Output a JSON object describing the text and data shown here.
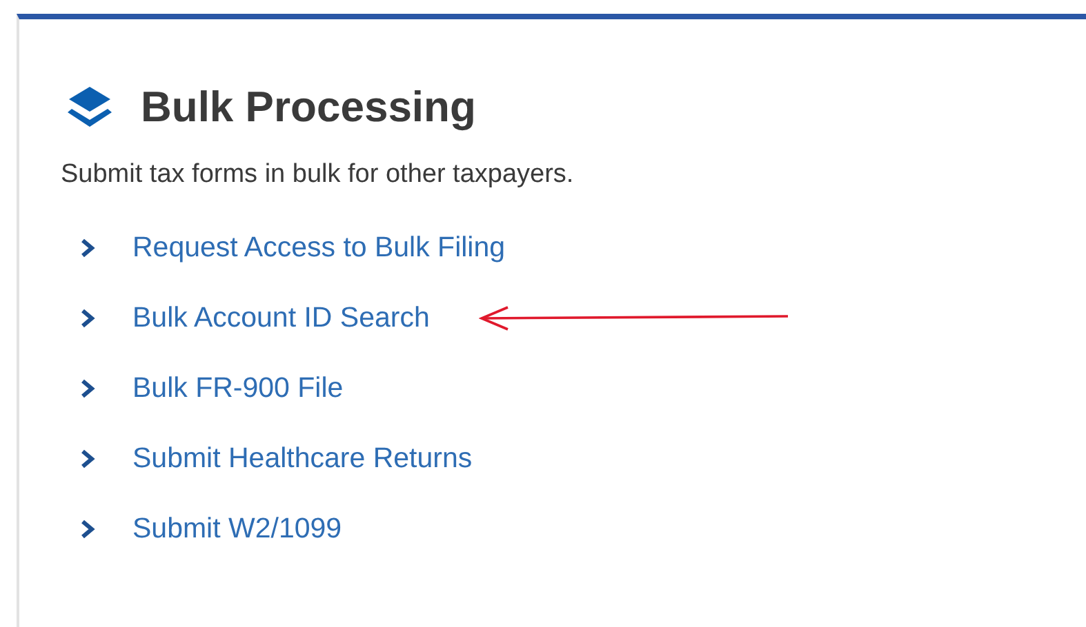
{
  "card": {
    "title": "Bulk Processing",
    "description": "Submit tax forms in bulk for other taxpayers.",
    "links": [
      {
        "label": "Request Access to Bulk Filing",
        "marked": false
      },
      {
        "label": "Bulk Account ID Search",
        "marked": true
      },
      {
        "label": "Bulk FR-900 File",
        "marked": false
      },
      {
        "label": "Submit Healthcare Returns",
        "marked": false
      },
      {
        "label": "Submit W2/1099",
        "marked": false
      }
    ]
  }
}
